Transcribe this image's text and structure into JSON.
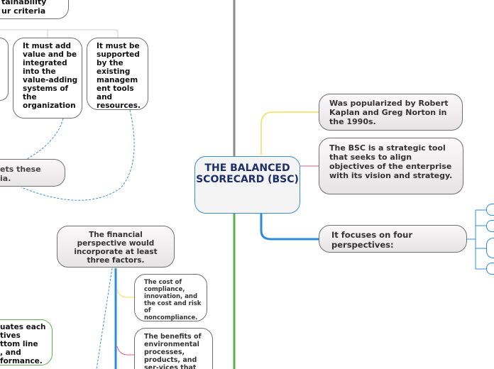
{
  "center": {
    "title": "THE BALANCED SCORECARD (BSC)"
  },
  "left": {
    "criteria_partial": "tainability\nur criteria",
    "criterion_value": "It must add value and be integrated into the value-adding systems of the organization",
    "criterion_tools": "It must be supported by the existing managem ent tools and resources.",
    "meets_partial": "ets these\nia.",
    "financial": "The financial perspective would incorporate at least three factors.",
    "factor_cost": "The cost of compliance, innovation, and the cost and risk of noncompliance.",
    "factor_benefits": "The benefits of environmental processes, products, and ser-vices that",
    "evaluates_partial": "uates each\ntives\nttom line\n, and\nformance."
  },
  "right": {
    "popularized": "Was popularized by Robert Kaplan and Greg Norton in the 1990s.",
    "definition": "The BSC is a strategic tool that seeks to align objectives of the enterprise with its vision and strategy.",
    "perspectives": "It focuses on four perspectives:"
  },
  "colors": {
    "center_border": "#3b8fd6",
    "center_text": "#1a2f6b",
    "yellow": "#f5dc50",
    "pink": "#e8588a",
    "blue": "#2b8be0",
    "green": "#5cb04a",
    "gray": "#8a8a8a"
  }
}
